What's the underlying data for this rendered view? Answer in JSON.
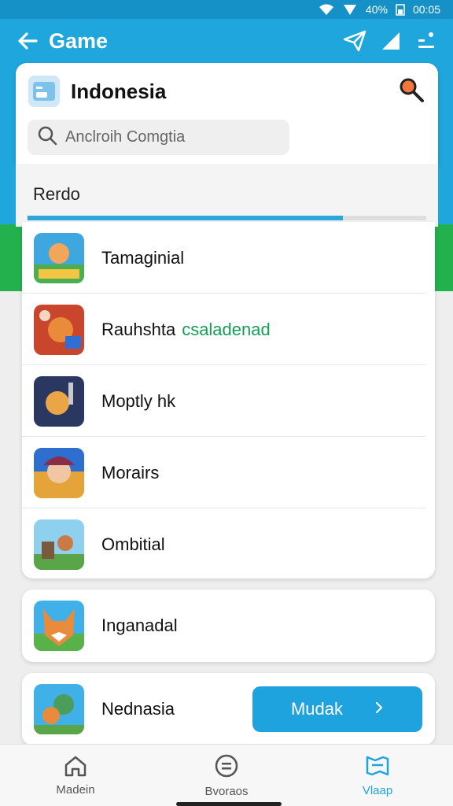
{
  "status_bar": {
    "battery": "40%",
    "time": "00:05"
  },
  "app_bar": {
    "title": "Game"
  },
  "header": {
    "title": "Indonesia",
    "search_placeholder": "Anclroih Comgtia"
  },
  "section": {
    "label": "Rerdo",
    "progress": 0.79
  },
  "list": {
    "items": [
      {
        "name": "Tamaginial",
        "accent": ""
      },
      {
        "name": "Rauhshta",
        "accent": "csaladenad"
      },
      {
        "name": "Moptly hk",
        "accent": ""
      },
      {
        "name": "Morairs",
        "accent": ""
      },
      {
        "name": "Ombitial",
        "accent": ""
      }
    ]
  },
  "cards": {
    "card1": {
      "name": "Inganadal"
    },
    "card2": {
      "name": "Nednasia",
      "button_label": "Mudak"
    }
  },
  "bottom_nav": {
    "items": [
      {
        "label": "Madein",
        "icon": "home-icon"
      },
      {
        "label": "Bvoraos",
        "icon": "chat-icon"
      },
      {
        "label": "Vlaap",
        "icon": "map-icon"
      }
    ]
  },
  "colors": {
    "primary_blue": "#1ea6dd",
    "green": "#22b14c",
    "accent_green_text": "#139e55"
  }
}
